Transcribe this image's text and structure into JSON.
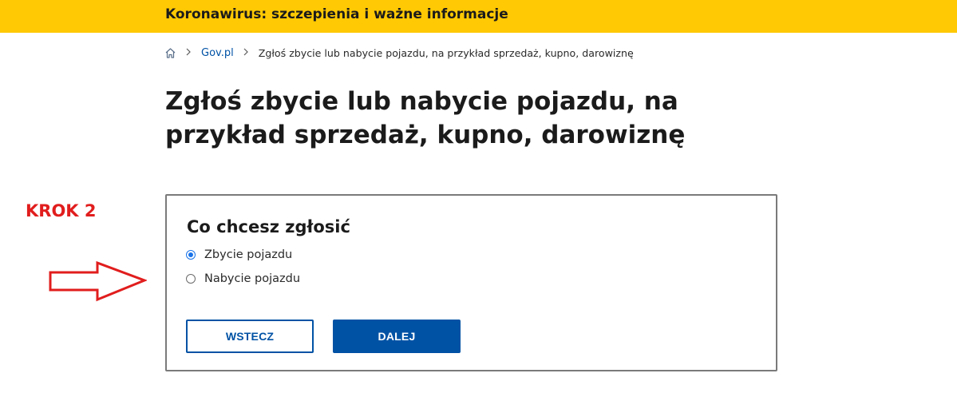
{
  "alert_bar": {
    "text": "Koronawirus: szczepienia i ważne informacje",
    "color": "#ffc903"
  },
  "breadcrumb": {
    "home_icon": "home-icon",
    "separator_icon": "chevron-right-icon",
    "items": [
      {
        "label": "Gov.pl"
      },
      {
        "label": "Zgłoś zbycie lub nabycie pojazdu, na przykład sprzedaż, kupno, darowiznę"
      }
    ]
  },
  "page": {
    "title": "Zgłoś zbycie lub nabycie pojazdu, na przykład sprzedaż, kupno, darowiznę"
  },
  "annotation": {
    "step_label": "KROK 2",
    "color": "#e11d1d",
    "arrow_icon": "arrow-right-icon"
  },
  "form": {
    "heading": "Co chcesz zgłosić",
    "options": [
      {
        "label": "Zbycie pojazdu",
        "selected": true
      },
      {
        "label": "Nabycie pojazdu",
        "selected": false
      }
    ],
    "back_label": "WSTECZ",
    "next_label": "DALEJ",
    "accent": "#0052a5"
  }
}
